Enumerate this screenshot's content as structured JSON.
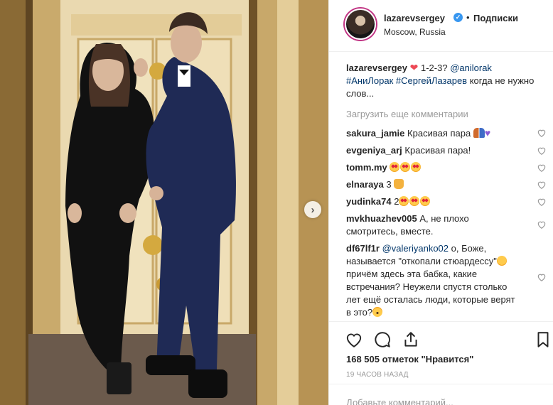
{
  "post": {
    "username": "lazarevsergey",
    "verified_mark": "✓",
    "dot": "•",
    "follow_label": "Подписки",
    "location": "Moscow, Russia"
  },
  "caption": {
    "user": "lazarevsergey",
    "text_before_mention": "1-2-3?",
    "mention": "@anilorak",
    "tag1": "#АниЛорак",
    "tag2": "#СергейЛазарев",
    "text_after": "когда не нужно слов..."
  },
  "load_more": "Загрузить еще комментарии",
  "comments": [
    {
      "user": "sakura_jamie",
      "text": "Красивая пара"
    },
    {
      "user": "evgeniya_arj",
      "text": "Красивая пара!"
    },
    {
      "user": "tomm.my",
      "text": ""
    },
    {
      "user": "elnaraya",
      "text": "3"
    },
    {
      "user": "yudinka74",
      "text": "2"
    },
    {
      "user": "mvkhuazhev005",
      "text": "А, не плохо смотритесь, вместе."
    },
    {
      "user": "df67lf1r",
      "mention": "@valeriyanko02",
      "text": "о, Боже, называется \"откопали стюардессу\"",
      "text2": "причём здесь эта бабка, какие встречания? Неужели спустя столько лет ещё осталась люди, которые верят в это?"
    }
  ],
  "likes": "168 505 отметок \"Нравится\"",
  "time": "19 ЧАСОВ НАЗАД",
  "add_comment_placeholder": "Добавьте комментарий...",
  "icons": [
    "heart-icon",
    "comment-icon",
    "share-icon",
    "bookmark-icon",
    "next-arrow-icon"
  ],
  "colors": {
    "verified": "#3897f0",
    "link": "#003569",
    "muted": "#999999",
    "text": "#262626"
  }
}
